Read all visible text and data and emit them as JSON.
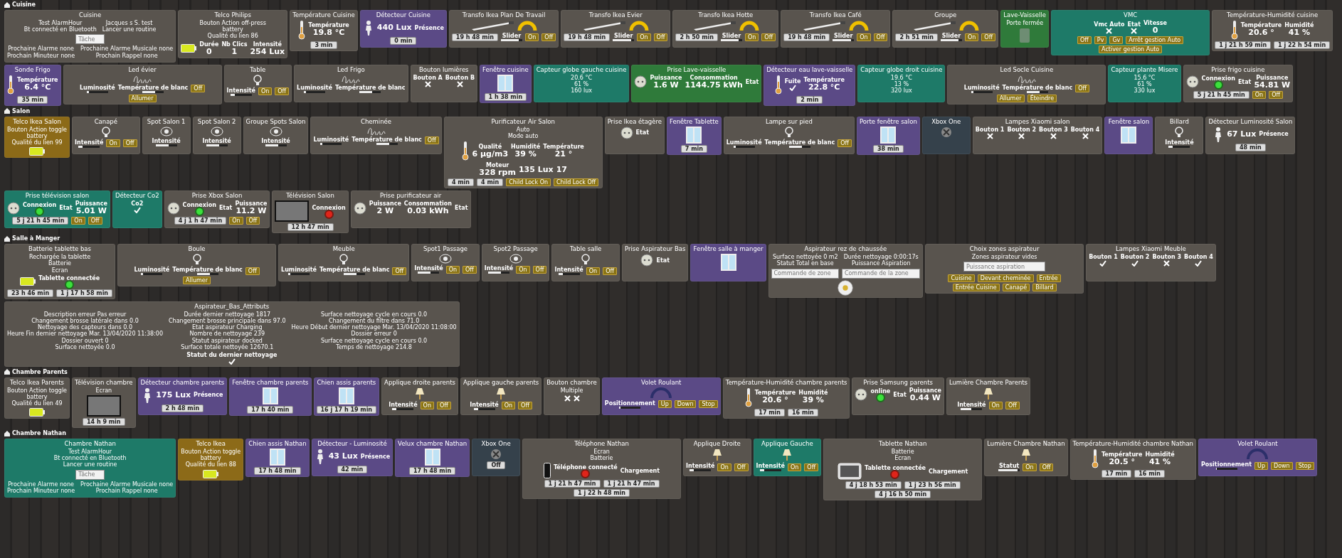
{
  "sections": [
    {
      "title": "Cuisine",
      "cards": [
        {
          "title": "Cuisine",
          "color": "#59544e",
          "kind": "none",
          "lines": [
            "Test AlarmHour",
            "Jacques s S. test",
            "Bt connecté en Bluetooth",
            "Lancer une routine"
          ],
          "fields": [
            {
              "placeholder": "Tâche"
            }
          ],
          "lines2": [
            "Prochaine Alarme none",
            "Prochaine Alarme Musicale none",
            "Prochain Minuteur none",
            "Prochain Rappel none"
          ]
        },
        {
          "title": "Telco Philips",
          "color": "#59544e",
          "kind": "battery",
          "lines": [
            "Bouton Action off-press",
            "battery",
            "Qualité du lien 86"
          ],
          "values": [
            {
              "label": "Durée",
              "value": "0"
            },
            {
              "label": "Nb Clics",
              "value": "1"
            },
            {
              "label": "Intensité",
              "value": "254 Lux"
            }
          ]
        },
        {
          "title": "Température Cuisine",
          "color": "#59544e",
          "kind": "thermo",
          "values": [
            {
              "label": "Température",
              "value": "19.8 °C"
            }
          ],
          "badges": [
            "3 min"
          ]
        },
        {
          "title": "Détecteur Cuisine",
          "color": "#5b4a86",
          "kind": "presence",
          "values": [
            {
              "value": "440 Lux"
            },
            {
              "label": "Présence"
            }
          ],
          "badges": [
            "0 min"
          ]
        },
        {
          "title": "Transfo Ikea Plan De Travail",
          "color": "#59544e",
          "kind": "strip",
          "badges": [
            "19 h 48 min"
          ],
          "sliders": [
            {
              "label": "Slider",
              "level": 0.85
            }
          ],
          "buttons": [
            "On",
            "Off"
          ]
        },
        {
          "title": "Transfo Ikea Evier",
          "color": "#59544e",
          "kind": "strip",
          "badges": [
            "19 h 48 min"
          ],
          "sliders": [
            {
              "label": "Slider",
              "level": 0.85
            }
          ],
          "buttons": [
            "On",
            "Off"
          ]
        },
        {
          "title": "Transfo Ikea Hotte",
          "color": "#59544e",
          "kind": "strip",
          "badges": [
            "2 h 50 min"
          ],
          "sliders": [
            {
              "label": "Slider",
              "level": 0.85
            }
          ],
          "buttons": [
            "On",
            "Off"
          ]
        },
        {
          "title": "Transfo Ikea Café",
          "color": "#59544e",
          "kind": "strip",
          "badges": [
            "19 h 48 min"
          ],
          "sliders": [
            {
              "label": "Slider",
              "level": 0.85
            }
          ],
          "buttons": [
            "On",
            "Off"
          ]
        },
        {
          "title": "Groupe",
          "color": "#59544e",
          "kind": "strip",
          "badges": [
            "2 h 51 min"
          ],
          "sliders": [
            {
              "label": "Slider",
              "level": 0.85
            }
          ],
          "buttons": [
            "On",
            "Off"
          ]
        },
        {
          "title": "Lave-Vaisselle",
          "color": "#2f7a3a",
          "kind": "door",
          "lines": [
            "Porte fermée"
          ]
        },
        {
          "title": "VMC",
          "color": "#1e7a68",
          "kind": "none",
          "switches": [
            {
              "label": "Vmc Auto",
              "on": false
            },
            {
              "label": "Etat",
              "on": false
            }
          ],
          "values": [
            {
              "label": "Vitesse",
              "value": "0"
            }
          ],
          "buttons": [
            "Off",
            "Pv",
            "Gv",
            "Arrêt gestion Auto",
            "Activer gestion Auto"
          ]
        },
        {
          "title": "Température-Humidité cuisine",
          "color": "#59544e",
          "kind": "thermo",
          "values": [
            {
              "label": "Température",
              "value": "20.6 °"
            },
            {
              "label": "Humidité",
              "value": "41 %"
            }
          ],
          "badges": [
            "1 j 21 h 59 min",
            "1 j 22 h 54 min"
          ]
        },
        {
          "title": "Sonde Frigo",
          "color": "#5b4a86",
          "kind": "thermo",
          "values": [
            {
              "label": "Température",
              "value": "6.4 °C"
            }
          ],
          "badges": [
            "35 min"
          ]
        },
        {
          "title": "Led évier",
          "color": "#59544e",
          "kind": "led",
          "buttons": [
            "Off",
            "Allumer"
          ],
          "sliders": [
            {
              "label": "Luminosité",
              "level": 0.1
            },
            {
              "label": "Température de blanc",
              "level": 0.6
            }
          ]
        },
        {
          "title": "Table",
          "color": "#59544e",
          "kind": "lamp",
          "sliders": [
            {
              "label": "Intensité",
              "level": 0.2
            }
          ],
          "buttons": [
            "On",
            "Off"
          ]
        },
        {
          "title": "Led Frigo",
          "color": "#59544e",
          "kind": "led",
          "sliders": [
            {
              "label": "Luminosité",
              "level": 0.1
            },
            {
              "label": "Température de blanc",
              "level": 0.6
            }
          ]
        },
        {
          "title": "Bouton lumières",
          "color": "#59544e",
          "kind": "none",
          "switches": [
            {
              "label": "Bouton A",
              "on": false
            },
            {
              "label": "Bouton B",
              "on": false
            }
          ]
        },
        {
          "title": "Fenêtre cuisine",
          "color": "#5b4a86",
          "kind": "window",
          "badges": [
            "1 h 38 min"
          ]
        },
        {
          "title": "Capteur globe gauche cuisine",
          "color": "#1e7a68",
          "kind": "none",
          "lines": [
            "20.6 °C",
            "61 %",
            "160 lux"
          ]
        },
        {
          "title": "Prise Lave-vaisselle",
          "color": "#2f7a3a",
          "kind": "plug",
          "values": [
            {
              "label": "Puissance",
              "value": "1.6 W"
            },
            {
              "label": "Consommation",
              "value": "1144.75 kWh"
            },
            {
              "label": "Etat"
            }
          ]
        },
        {
          "title": "Détecteur eau lave-vaisselle",
          "color": "#5b4a86",
          "kind": "thermo",
          "switches": [
            {
              "label": "Fuite",
              "on": true
            }
          ],
          "values": [
            {
              "label": "Température",
              "value": "22.8 °C"
            }
          ],
          "badges": [
            "2 min"
          ]
        },
        {
          "title": "Capteur globe droit cuisine",
          "color": "#1e7a68",
          "kind": "none",
          "lines": [
            "19.6 °C",
            "13 %",
            "320 lux"
          ]
        },
        {
          "title": "Led Socle Cuisine",
          "color": "#59544e",
          "kind": "led",
          "buttons": [
            "Off",
            "Allumer",
            "Éteindre"
          ],
          "sliders": [
            {
              "label": "Luminosité",
              "level": 0.1
            },
            {
              "label": "Température de blanc",
              "level": 0.6
            }
          ]
        },
        {
          "title": "Capteur plante Misere",
          "color": "#1e7a68",
          "kind": "none",
          "lines": [
            "15.6 °C",
            "61 %",
            "330 lux"
          ]
        },
        {
          "title": "Prise frigo cuisine",
          "color": "#59544e",
          "kind": "plug",
          "statuses": [
            {
              "label": "Connexion",
              "on": true
            }
          ],
          "values": [
            {
              "label": "Etat"
            },
            {
              "label": "Puissance",
              "value": "54.81 W"
            }
          ],
          "badges": [
            "5 j 21 h 45 min"
          ],
          "buttons": [
            "On",
            "Off"
          ]
        }
      ]
    },
    {
      "title": "Salon",
      "cards": [
        {
          "title": "Telco Ikea Salon",
          "color": "#8c6a18",
          "kind": "battery",
          "lines": [
            "Bouton Action toggle",
            "battery",
            "Qualité du lien 99"
          ]
        },
        {
          "title": "Canapé",
          "color": "#59544e",
          "kind": "lamp",
          "sliders": [
            {
              "label": "Intensité",
              "level": 0.2
            }
          ],
          "buttons": [
            "On",
            "Off"
          ]
        },
        {
          "title": "Spot Salon 1",
          "color": "#59544e",
          "kind": "spot",
          "sliders": [
            {
              "label": "Intensité",
              "level": 0.6
            }
          ]
        },
        {
          "title": "Spot Salon 2",
          "color": "#59544e",
          "kind": "spot",
          "sliders": [
            {
              "label": "Intensité",
              "level": 0.6
            }
          ]
        },
        {
          "title": "Groupe Spots Salon",
          "color": "#59544e",
          "kind": "spot",
          "sliders": [
            {
              "label": "Intensité",
              "level": 0.6
            }
          ]
        },
        {
          "title": "Cheminée",
          "color": "#59544e",
          "kind": "led",
          "buttons": [
            "Off"
          ],
          "sliders": [
            {
              "label": "Luminosité",
              "level": 0.1
            },
            {
              "label": "Température de blanc",
              "level": 0.6
            }
          ]
        },
        {
          "title": "Purificateur Air Salon",
          "color": "#59544e",
          "kind": "thermo",
          "lines": [
            "Auto",
            "Mode auto"
          ],
          "values": [
            {
              "label": "Qualité",
              "value": "6 µg/m3"
            },
            {
              "label": "Humidité",
              "value": "39 %"
            },
            {
              "label": "Température",
              "value": "21 °"
            },
            {
              "label": "Moteur",
              "value": "328 rpm"
            },
            {
              "value": "135 Lux"
            },
            {
              "value": "17"
            }
          ],
          "badges": [
            "4 min",
            "4 min"
          ],
          "buttons": [
            "Child Lock On",
            "Child Lock Off"
          ]
        },
        {
          "title": "Prise Ikea étagère",
          "color": "#59544e",
          "kind": "plug",
          "values": [
            {
              "label": "Etat"
            }
          ]
        },
        {
          "title": "Fenêtre Tablette",
          "color": "#5b4a86",
          "kind": "window",
          "badges": [
            "7 min"
          ]
        },
        {
          "title": "Lampe sur pied",
          "color": "#59544e",
          "kind": "lamp",
          "buttons": [
            "Off"
          ],
          "sliders": [
            {
              "label": "Luminosité",
              "level": 0.1
            },
            {
              "label": "Température de blanc",
              "level": 0.6
            }
          ]
        },
        {
          "title": "Porte fenêtre salon",
          "color": "#5b4a86",
          "kind": "window",
          "badges": [
            "38 min"
          ]
        },
        {
          "title": "Xbox One",
          "color": "#35414b",
          "kind": "console"
        },
        {
          "title": "Lampes Xiaomi salon",
          "color": "#59544e",
          "kind": "none",
          "switches": [
            {
              "label": "Bouton 1",
              "on": false
            },
            {
              "label": "Bouton 2",
              "on": false
            },
            {
              "label": "Bouton 3",
              "on": false
            },
            {
              "label": "Bouton 4",
              "on": false
            }
          ]
        },
        {
          "title": "Fenêtre salon",
          "color": "#5b4a86",
          "kind": "window"
        },
        {
          "title": "Billard",
          "color": "#59544e",
          "kind": "lamp",
          "sliders": [
            {
              "label": "Intensité",
              "level": 0.2
            }
          ]
        },
        {
          "title": "Détecteur Luminosité Salon",
          "color": "#59544e",
          "kind": "presence",
          "values": [
            {
              "value": "67 Lux"
            },
            {
              "label": "Présence"
            }
          ],
          "badges": [
            "48 min"
          ]
        },
        {
          "title": "Prise télévision salon",
          "color": "#1e7a68",
          "kind": "plug",
          "statuses": [
            {
              "label": "Connexion",
              "on": true
            }
          ],
          "values": [
            {
              "label": "Etat"
            },
            {
              "label": "Puissance",
              "value": "5.01 W"
            }
          ],
          "badges": [
            "5 j 21 h 45 min"
          ],
          "buttons": [
            "On",
            "Off"
          ]
        },
        {
          "title": "Détecteur Co2",
          "color": "#1e7a68",
          "kind": "none",
          "switches": [
            {
              "label": "Co2",
              "on": true
            }
          ]
        },
        {
          "title": "Prise Xbox Salon",
          "color": "#59544e",
          "kind": "plug",
          "statuses": [
            {
              "label": "Connexion",
              "on": true
            }
          ],
          "values": [
            {
              "label": "Etat"
            },
            {
              "label": "Puissance",
              "value": "11.2 W"
            }
          ],
          "badges": [
            "4 j 1 h 47 min"
          ],
          "buttons": [
            "On",
            "Off"
          ]
        },
        {
          "title": "Télévision Salon",
          "color": "#59544e",
          "kind": "tv",
          "statuses": [
            {
              "label": "Connexion",
              "on": false
            }
          ],
          "badges": [
            "12 h 47 min"
          ]
        },
        {
          "title": "Prise purificateur air",
          "color": "#59544e",
          "kind": "plug",
          "values": [
            {
              "label": "Puissance",
              "value": "2 W"
            },
            {
              "label": "Consommation",
              "value": "0.03 kWh"
            },
            {
              "label": "Etat"
            }
          ]
        }
      ]
    },
    {
      "title": "Salle à Manger",
      "cards": [
        {
          "title": "Batterie tablette bas",
          "color": "#59544e",
          "kind": "battery",
          "statuses": [
            {
              "label": "Tablette connectée",
              "on": true
            }
          ],
          "lines": [
            "Rechargée la tablette",
            "Batterie",
            "Ecran"
          ],
          "badges": [
            "23 h 46 min",
            "1 j 17 h 58 min"
          ]
        },
        {
          "title": "Boule",
          "color": "#59544e",
          "kind": "lamp",
          "buttons": [
            "Off",
            "Allumer"
          ],
          "sliders": [
            {
              "label": "Luminosité",
              "level": 0.1
            },
            {
              "label": "Température de blanc",
              "level": 0.6
            }
          ]
        },
        {
          "title": "Meuble",
          "color": "#59544e",
          "kind": "lamp",
          "buttons": [
            "Off"
          ],
          "sliders": [
            {
              "label": "Luminosité",
              "level": 0.1
            },
            {
              "label": "Température de blanc",
              "level": 0.6
            }
          ]
        },
        {
          "title": "Spot1 Passage",
          "color": "#59544e",
          "kind": "spot",
          "buttons": [
            "On",
            "Off"
          ],
          "sliders": [
            {
              "label": "Intensité",
              "level": 0.6
            }
          ]
        },
        {
          "title": "Spot2 Passage",
          "color": "#59544e",
          "kind": "spot",
          "buttons": [
            "On",
            "Off"
          ],
          "sliders": [
            {
              "label": "Intensité",
              "level": 0.6
            }
          ]
        },
        {
          "title": "Table salle",
          "color": "#59544e",
          "kind": "lamp",
          "buttons": [
            "On",
            "Off"
          ],
          "sliders": [
            {
              "label": "Intensité",
              "level": 0.2
            }
          ]
        },
        {
          "title": "Prise Aspirateur Bas",
          "color": "#59544e",
          "kind": "plug",
          "values": [
            {
              "label": "Etat"
            }
          ]
        },
        {
          "title": "Fenêtre salle à manger",
          "color": "#5b4a86",
          "kind": "window"
        },
        {
          "title": "Aspirateur rez de chaussée",
          "color": "#59544e",
          "kind": "vacuum",
          "lines": [
            "Surface nettoyée 0 m2",
            "Durée nettoyage 0:00:17s",
            "Statut Total en base",
            "Puissance Aspiration"
          ],
          "fields": [
            {
              "placeholder": "Commande de zone"
            },
            {
              "placeholder": "Commande de la zone"
            }
          ]
        },
        {
          "title": "Choix zones aspirateur",
          "color": "#59544e",
          "kind": "none",
          "lines": [
            "Zones aspirateur vides"
          ],
          "buttons": [
            "Cuisine",
            "Devant cheminée",
            "Entrée",
            "Entrée Cuisine",
            "Canapé",
            "Billard"
          ],
          "fields": [
            {
              "placeholder": "Puissance aspiration"
            }
          ]
        },
        {
          "title": "Lampes Xiaomi Meuble",
          "color": "#59544e",
          "kind": "none",
          "switches": [
            {
              "label": "Bouton 1",
              "on": true
            },
            {
              "label": "Bouton 2",
              "on": true
            },
            {
              "label": "Bouton 3",
              "on": false
            },
            {
              "label": "Bouton 4",
              "on": true
            }
          ]
        },
        {
          "title": "Aspirateur_Bas_Attributs",
          "color": "#59544e",
          "kind": "none",
          "lines": [
            "Description erreur Pas erreur",
            "Durée dernier nettoyage 1817",
            "Surface nettoyage cycle en cours 0.0",
            "Changement brosse latérale dans 0.0",
            "Changement brosse principale dans 97.0",
            "Changement du filtre dans 71.0",
            "Nettoyage des capteurs dans 0.0",
            "Etat aspirateur Charging",
            "Heure Début dernier nettoyage Mar. 13/04/2020 11:08:00",
            "Heure Fin dernier nettoyage Mar. 13/04/2020 11:38:00",
            "Nombre de nettoyage 239",
            "Dossier erreur 0",
            "Dossier ouvert 0",
            "Statut aspirateur docked",
            "Surface nettoyage cycle en cours 0.0",
            "Surface nettoyée 0.0",
            "Surface totale nettoyée 12670.1",
            "Temps de nettoyage 214.8"
          ],
          "switches": [
            {
              "label": "Statut du dernier nettoyage",
              "on": true
            }
          ]
        }
      ]
    },
    {
      "title": "Chambre Parents",
      "cards": [
        {
          "title": "Telco Ikea Parents",
          "color": "#59544e",
          "kind": "battery",
          "lines": [
            "Bouton Action toggle",
            "battery",
            "Qualité du lien 49"
          ]
        },
        {
          "title": "Télévision chambre",
          "color": "#59544e",
          "kind": "tv",
          "lines": [
            "Ecran"
          ],
          "badges": [
            "14 h 9 min"
          ]
        },
        {
          "title": "Détecteur chambre parents",
          "color": "#5b4a86",
          "kind": "presence",
          "values": [
            {
              "value": "175 Lux"
            },
            {
              "label": "Présence"
            }
          ],
          "badges": [
            "2 h 48 min"
          ]
        },
        {
          "title": "Fenêtre chambre parents",
          "color": "#5b4a86",
          "kind": "window",
          "badges": [
            "17 h 40 min"
          ]
        },
        {
          "title": "Chien assis parents",
          "color": "#5b4a86",
          "kind": "window",
          "badges": [
            "16 j 17 h 19 min"
          ]
        },
        {
          "title": "Applique droite parents",
          "color": "#59544e",
          "kind": "wall",
          "sliders": [
            {
              "label": "Intensité",
              "level": 0.2
            }
          ],
          "buttons": [
            "On",
            "Off"
          ]
        },
        {
          "title": "Applique gauche parents",
          "color": "#59544e",
          "kind": "wall",
          "sliders": [
            {
              "label": "Intensité",
              "level": 0.2
            }
          ],
          "buttons": [
            "On",
            "Off"
          ]
        },
        {
          "title": "Bouton chambre",
          "color": "#59544e",
          "kind": "none",
          "switches": [
            {
              "on": false
            },
            {
              "on": false
            }
          ],
          "lines": [
            "Multiple"
          ]
        },
        {
          "title": "Volet Roulant",
          "color": "#5b4a86",
          "kind": "shutter",
          "buttons": [
            "Up",
            "Down",
            "Stop"
          ],
          "sliders": [
            {
              "label": "Positionnement",
              "level": 0.05
            }
          ]
        },
        {
          "title": "Température-Humidité chambre parents",
          "color": "#59544e",
          "kind": "thermo",
          "values": [
            {
              "label": "Température",
              "value": "20.6 °"
            },
            {
              "label": "Humidité",
              "value": "39 %"
            }
          ],
          "badges": [
            "17 min",
            "16 min"
          ]
        },
        {
          "title": "Prise Samsung parents",
          "color": "#59544e",
          "kind": "plug",
          "statuses": [
            {
              "label": "online",
              "on": true
            }
          ],
          "values": [
            {
              "label": "Etat"
            },
            {
              "label": "Puissance",
              "value": "0.44 W"
            }
          ]
        },
        {
          "title": "Lumière Chambre Parents",
          "color": "#59544e",
          "kind": "wall",
          "buttons": [
            "On",
            "Off"
          ],
          "sliders": [
            {
              "label": "Intensité",
              "level": 0.5
            }
          ]
        }
      ]
    },
    {
      "title": "Chambre Nathan",
      "cards": [
        {
          "title": "Chambre Nathan",
          "color": "#1e7a68",
          "kind": "none",
          "lines": [
            "Test AlarmHour",
            "Bt connecté en Bluetooth",
            "Lancer une routine"
          ],
          "fields": [
            {
              "placeholder": "Tâche"
            }
          ],
          "lines2": [
            "Prochaine Alarme none",
            "Prochaine Alarme Musicale none",
            "Prochain Minuteur none",
            "Prochain Rappel none"
          ]
        },
        {
          "title": "Telco Ikea",
          "color": "#8c6a18",
          "kind": "battery",
          "lines": [
            "Bouton Action toggle",
            "battery",
            "Qualité du lien 88"
          ]
        },
        {
          "title": "Chien assis Nathan",
          "color": "#5b4a86",
          "kind": "window",
          "badges": [
            "17 h 48 min"
          ]
        },
        {
          "title": "Détecteur - Luminosité",
          "color": "#5b4a86",
          "kind": "presence",
          "values": [
            {
              "value": "43 Lux"
            },
            {
              "label": "Présence"
            }
          ],
          "badges": [
            "42 min"
          ]
        },
        {
          "title": "Velux chambre Nathan",
          "color": "#5b4a86",
          "kind": "window",
          "badges": [
            "17 h 48 min"
          ]
        },
        {
          "title": "Xbox One",
          "color": "#35414b",
          "kind": "console",
          "badges": [
            "Off"
          ]
        },
        {
          "title": "Téléphone Nathan",
          "color": "#59544e",
          "kind": "phone",
          "lines": [
            "Ecran",
            "Batterie"
          ],
          "statuses": [
            {
              "label": "Téléphone connecté",
              "on": false
            }
          ],
          "values": [
            {
              "label": "Chargement"
            }
          ],
          "badges": [
            "1 j 21 h 47 min",
            "1 j 21 h 47 min",
            "1 j 22 h 48 min"
          ]
        },
        {
          "title": "Applique Droite",
          "color": "#59544e",
          "kind": "wall",
          "sliders": [
            {
              "label": "Intensité",
              "level": 0.2
            }
          ],
          "buttons": [
            "On",
            "Off"
          ]
        },
        {
          "title": "Applique Gauche",
          "color": "#1e7a68",
          "kind": "wall",
          "sliders": [
            {
              "label": "Intensité",
              "level": 0.2
            }
          ],
          "buttons": [
            "On",
            "Off"
          ]
        },
        {
          "title": "Tablette Nathan",
          "color": "#59544e",
          "kind": "tablet",
          "lines": [
            "Batterie",
            "Ecran"
          ],
          "statuses": [
            {
              "label": "Tablette connectée",
              "on": false
            }
          ],
          "values": [
            {
              "label": "Chargement"
            }
          ],
          "badges": [
            "4 j 18 h 53 min",
            "1 j 23 h 56 min",
            "4 j 16 h 50 min"
          ]
        },
        {
          "title": "Lumière Chambre Nathan",
          "color": "#59544e",
          "kind": "wall",
          "buttons": [
            "On",
            "Off"
          ],
          "sliders": [
            {
              "label": "Statut",
              "level": 0.9
            }
          ]
        },
        {
          "title": "Température-Humidité chambre Nathan",
          "color": "#59544e",
          "kind": "thermo",
          "values": [
            {
              "label": "Température",
              "value": "20.5 °"
            },
            {
              "label": "Humidité",
              "value": "41 %"
            }
          ],
          "badges": [
            "17 min",
            "16 min"
          ]
        },
        {
          "title": "Volet Roulant",
          "color": "#5b4a86",
          "kind": "shutter",
          "buttons": [
            "Up",
            "Down",
            "Stop"
          ],
          "sliders": [
            {
              "label": "Positionnement",
              "level": 0.05
            }
          ]
        }
      ]
    }
  ]
}
